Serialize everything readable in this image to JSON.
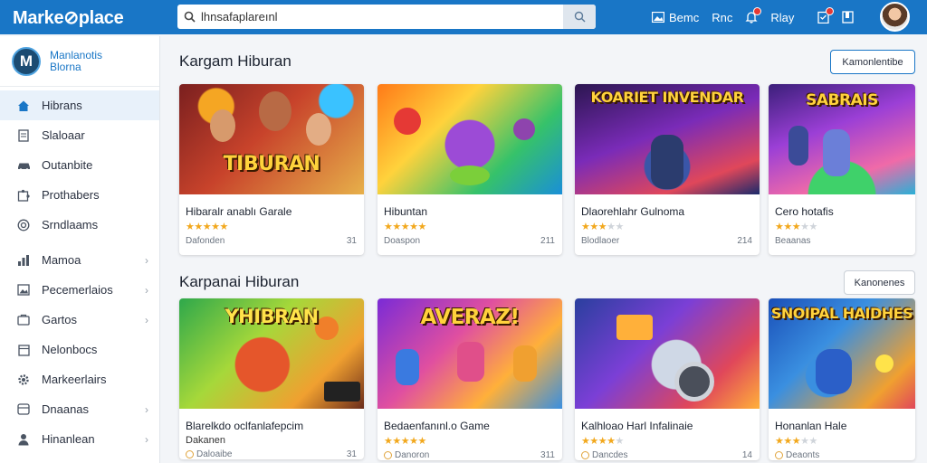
{
  "header": {
    "brand": "Marke⊘place",
    "search_value": "lhnsafaplareınl",
    "nav": [
      {
        "label": "Bemc"
      },
      {
        "label": "Rnc"
      },
      {
        "label": ""
      },
      {
        "label": "Rlay"
      }
    ]
  },
  "sidebar": {
    "logo_letter": "M",
    "profile_name": "Manlanotis",
    "profile_sub": "Blorna",
    "items": [
      {
        "label": "Hibrans",
        "icon": "home-icon"
      },
      {
        "label": "Slaloaar",
        "icon": "document-icon"
      },
      {
        "label": "Outanbite",
        "icon": "car-icon"
      },
      {
        "label": "Prothabers",
        "icon": "puzzle-icon"
      },
      {
        "label": "Srndlaams",
        "icon": "target-icon"
      },
      {
        "label": "Mamoa",
        "icon": "chart-icon"
      },
      {
        "label": "Pecemerlaios",
        "icon": "image-icon"
      },
      {
        "label": "Gartos",
        "icon": "cart-icon"
      },
      {
        "label": "Nelonbocs",
        "icon": "calendar-icon"
      },
      {
        "label": "Markeerlairs",
        "icon": "gear-icon"
      },
      {
        "label": "Dnaanas",
        "icon": "box-icon"
      },
      {
        "label": "Hinanlean",
        "icon": "user-icon"
      }
    ]
  },
  "sections": [
    {
      "title": "Kargam Hiburan",
      "button": "Kamonlentibe",
      "cards": [
        {
          "thumb_text": "TIBURAN",
          "name": "Hibaralr anablı Garale",
          "rating": 5,
          "meta_left": "Dafonden",
          "meta_right": "31"
        },
        {
          "thumb_text": "",
          "name": "Hibuntan",
          "rating": 5,
          "meta_left": "Doaspon",
          "meta_right": "211"
        },
        {
          "thumb_text": "KOARIET INVENDAR",
          "name": "Dlaorehlahr Gulnoma",
          "rating": 3,
          "meta_left": "Blodlaoer",
          "meta_right": "214"
        },
        {
          "thumb_text": "SABRAIS",
          "name": "Cero hotafis",
          "rating": 3,
          "meta_left": "Beaanas",
          "meta_right": ""
        }
      ]
    },
    {
      "title": "Karpanai Hiburan",
      "button": "Kanonenes",
      "cards": [
        {
          "thumb_text": "YHIBRAN",
          "name": "Blarelkdo oclfanlafepcim",
          "rating": 0,
          "meta_left": "Dakanen",
          "meta_right": "31",
          "sub_line": "Dakanen",
          "meta_left2": "Daloaibe"
        },
        {
          "thumb_text": "AVERAZ!",
          "name": "Bedaenfanınl.o Game",
          "rating": 5,
          "meta_left": "Danoron",
          "meta_right": "311"
        },
        {
          "thumb_text": "",
          "name": "Kalhloao Harl Infalinaie",
          "rating": 4,
          "meta_left": "Dancdes",
          "meta_right": "14"
        },
        {
          "thumb_text": "SNOIPAL HAIDHES",
          "name": "Honanlan Hale",
          "rating": 3,
          "meta_left": "Deaonts",
          "meta_right": ""
        }
      ]
    }
  ],
  "colors": {
    "brand_blue": "#1976c6",
    "star": "#f2a81d",
    "active_bg": "#e8f1fa"
  }
}
